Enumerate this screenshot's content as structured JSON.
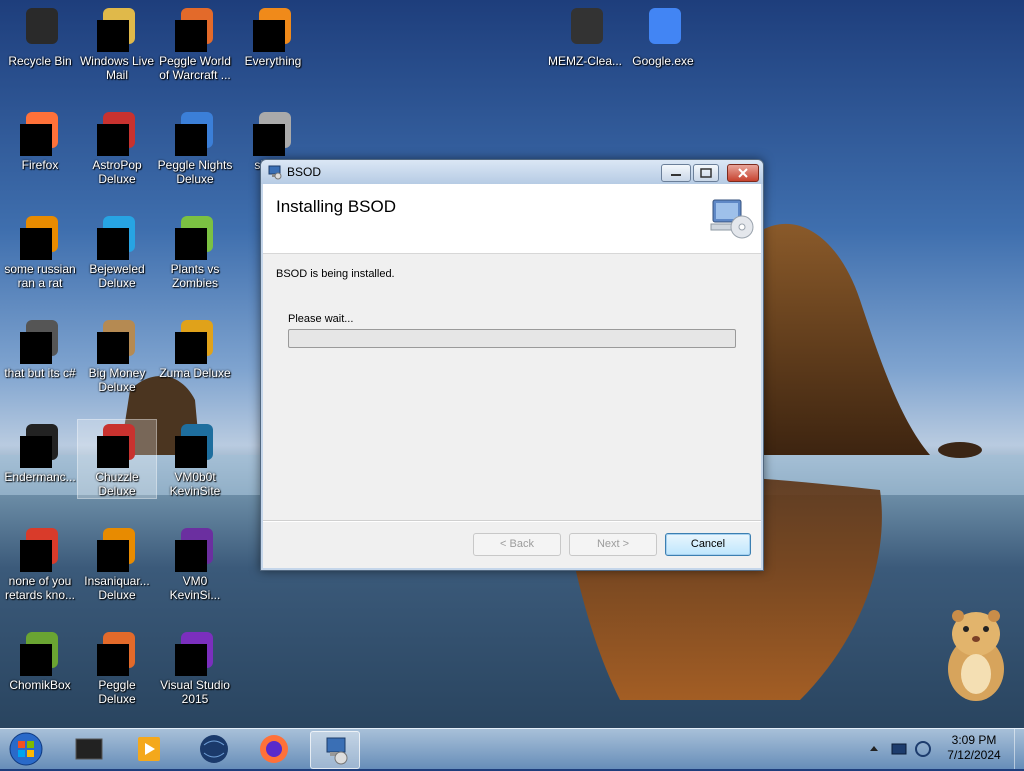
{
  "desktop_icons": [
    {
      "label": "Recycle Bin",
      "icon": "recycle-bin-icon"
    },
    {
      "label": "Windows Live Mail",
      "icon": "mail-icon"
    },
    {
      "label": "Peggle World of Warcraft ...",
      "icon": "peggle-wow-icon"
    },
    {
      "label": "Everything",
      "icon": "everything-search-icon"
    },
    {
      "label": "MEMZ-Clea...",
      "icon": "memz-icon"
    },
    {
      "label": "Google.exe",
      "icon": "google-icon"
    },
    {
      "label": "Firefox",
      "icon": "firefox-icon"
    },
    {
      "label": "AstroPop Deluxe",
      "icon": "astropop-icon"
    },
    {
      "label": "Peggle Nights Deluxe",
      "icon": "peggle-nights-icon"
    },
    {
      "label": "shi ask",
      "icon": "shortcut-icon"
    },
    {
      "label": "some russian ran a rat",
      "icon": "rat-icon"
    },
    {
      "label": "Bejeweled Deluxe",
      "icon": "bejeweled-icon"
    },
    {
      "label": "Plants vs Zombies",
      "icon": "plants-vs-zombies-icon"
    },
    {
      "label": "that but its c#",
      "icon": "window-stack-icon"
    },
    {
      "label": "Big Money Deluxe",
      "icon": "money-bag-icon"
    },
    {
      "label": "Zuma Deluxe",
      "icon": "zuma-icon"
    },
    {
      "label": "Endermanc...",
      "icon": "terminal-icon"
    },
    {
      "label": "Chuzzle Deluxe",
      "icon": "chuzzle-icon"
    },
    {
      "label": "VM0b0t KevinSite",
      "icon": "vm-icon"
    },
    {
      "label": "none of you retards kno...",
      "icon": "red-ball-icon"
    },
    {
      "label": "Insaniquar... Deluxe",
      "icon": "fish-icon"
    },
    {
      "label": "VM0 KevinSi...",
      "icon": "vm-purple-icon"
    },
    {
      "label": "ChomikBox",
      "icon": "hamster-box-icon"
    },
    {
      "label": "Peggle Deluxe",
      "icon": "peggle-icon"
    },
    {
      "label": "Visual Studio 2015",
      "icon": "visual-studio-icon"
    }
  ],
  "installer": {
    "title": "BSOD",
    "heading": "Installing BSOD",
    "status": "BSOD is being installed.",
    "wait_label": "Please wait...",
    "progress": 0,
    "back_label": "< Back",
    "next_label": "Next >",
    "cancel_label": "Cancel"
  },
  "taskbar": {
    "items": [
      "start-orb",
      "folder-icon",
      "media-player-icon",
      "globe-icon",
      "firefox-icon",
      "installer-icon"
    ],
    "time": "3:09 PM",
    "date": "7/12/2024"
  },
  "colors": {
    "cancel_border": "#3c7fb1",
    "close_button": "#c7432f"
  }
}
